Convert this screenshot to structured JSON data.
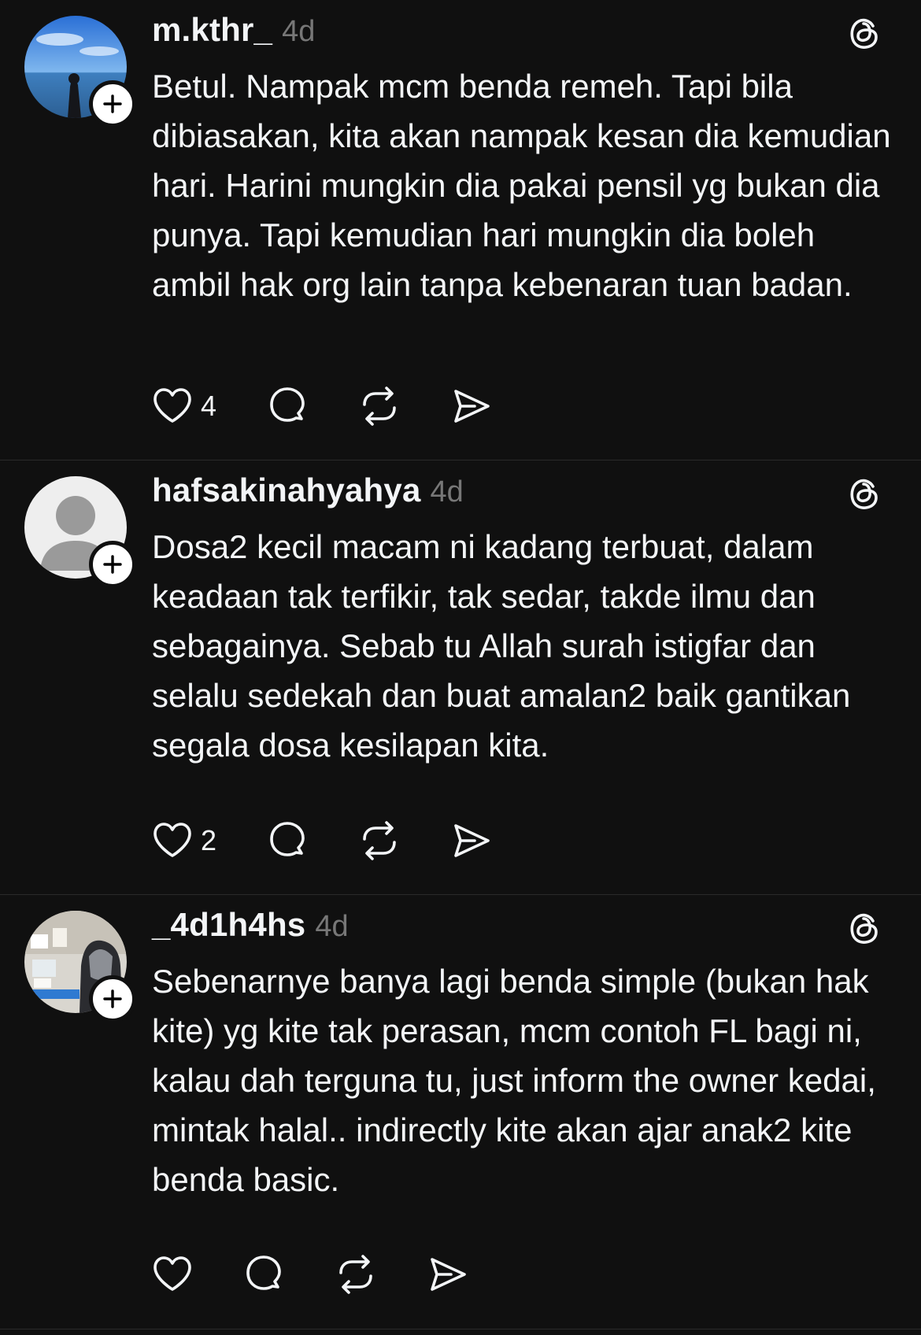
{
  "posts": [
    {
      "username": "m.kthr_",
      "time": "4d",
      "text": "Betul. Nampak mcm benda remeh. Tapi bila dibiasakan, kita akan nampak kesan dia kemudian hari. Harini mungkin dia pakai pensil yg bukan dia punya. Tapi kemudian hari mungkin dia boleh ambil hak org lain tanpa kebenaran tuan badan.",
      "likes": "4"
    },
    {
      "username": "hafsakinahyahya",
      "time": "4d",
      "text": "Dosa2 kecil macam ni kadang terbuat, dalam keadaan tak terfikir, tak sedar, takde ilmu dan sebagainya. Sebab tu Allah surah istigfar dan selalu sedekah dan buat amalan2 baik gantikan segala dosa kesilapan kita.",
      "likes": "2"
    },
    {
      "username": "_4d1h4hs",
      "time": "4d",
      "text": "Sebenarnye banya lagi benda simple (bukan hak kite) yg kite tak perasan, mcm contoh FL bagi ni, kalau dah terguna tu, just inform the owner kedai, mintak halal.. indirectly kite akan ajar anak2 kite benda basic.",
      "likes": ""
    }
  ],
  "icons": {
    "like": "heart-icon",
    "reply": "comment-icon",
    "repost": "repost-icon",
    "share": "share-icon",
    "app": "threads-icon",
    "follow": "plus-icon"
  }
}
